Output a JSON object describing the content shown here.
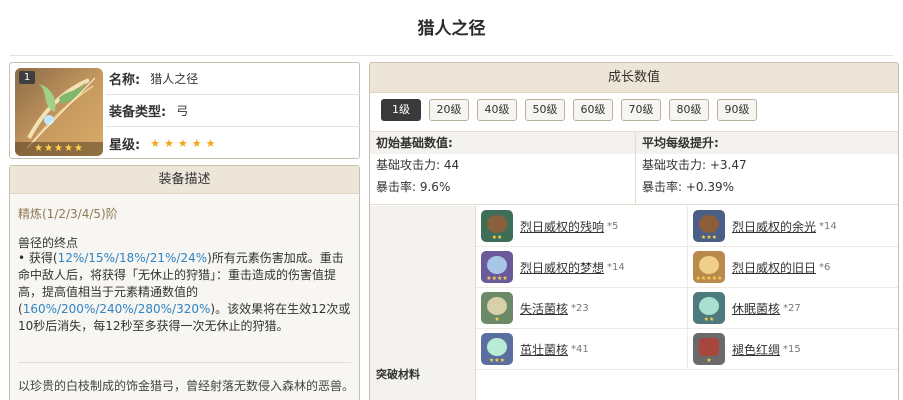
{
  "page": {
    "title": "猎人之径"
  },
  "weapon": {
    "rarity_badge": "1",
    "name_label": "名称:",
    "name": "猎人之径",
    "type_label": "装备类型:",
    "type": "弓",
    "stars_label": "星级:",
    "stars": "★★★★★",
    "thumb_stars": "★★★★★"
  },
  "description": {
    "header": "装备描述",
    "refine": "精炼(1/2/3/4/5)阶",
    "passive_name": "兽径的终点",
    "passive_parts": [
      "• 获得(",
      "12%/15%/18%/21%/24%",
      ")所有元素伤害加成。重击命中敌人后，将获得「无休止的狩猎」：重击造成的伤害值提高，提高值相当于元素精通数值的(",
      "160%/200%/240%/280%/320%",
      ")。该效果将在生效12次或10秒后消失，每12秒至多获得一次无休止的狩猎。"
    ],
    "flavor": "以珍贵的白枝制成的饰金猎弓，曾经射落无数侵入森林的恶兽。"
  },
  "growth": {
    "header": "成长数值",
    "levels": [
      "1级",
      "20级",
      "40级",
      "50级",
      "60级",
      "70级",
      "80级",
      "90级"
    ],
    "active_level": "1级",
    "base": {
      "title": "初始基础数值:",
      "atk": "基础攻击力: 44",
      "crit": "暴击率: 9.6%"
    },
    "avg": {
      "title": "平均每级提升:",
      "atk": "基础攻击力: +3.47",
      "crit": "暴击率: +0.39%"
    },
    "materials_label": "突破材料",
    "materials": [
      {
        "name": "烈日威权的残响",
        "count": "*5",
        "icon": "relic-echo-icon"
      },
      {
        "name": "烈日威权的余光",
        "count": "*14",
        "icon": "relic-afterglow-icon"
      },
      {
        "name": "烈日威权的梦想",
        "count": "*14",
        "icon": "relic-dream-icon"
      },
      {
        "name": "烈日威权的旧日",
        "count": "*6",
        "icon": "relic-past-icon"
      },
      {
        "name": "失活菌核",
        "count": "*23",
        "icon": "inactive-sclerotium-icon"
      },
      {
        "name": "休眠菌核",
        "count": "*27",
        "icon": "dormant-sclerotium-icon"
      },
      {
        "name": "茁壮菌核",
        "count": "*41",
        "icon": "robust-sclerotium-icon"
      },
      {
        "name": "褪色红绸",
        "count": "*15",
        "icon": "faded-red-satin-icon"
      }
    ]
  },
  "colors": {
    "accent": "#2d85c4",
    "header_bg": "#ece5d8",
    "star": "#f0a818"
  }
}
